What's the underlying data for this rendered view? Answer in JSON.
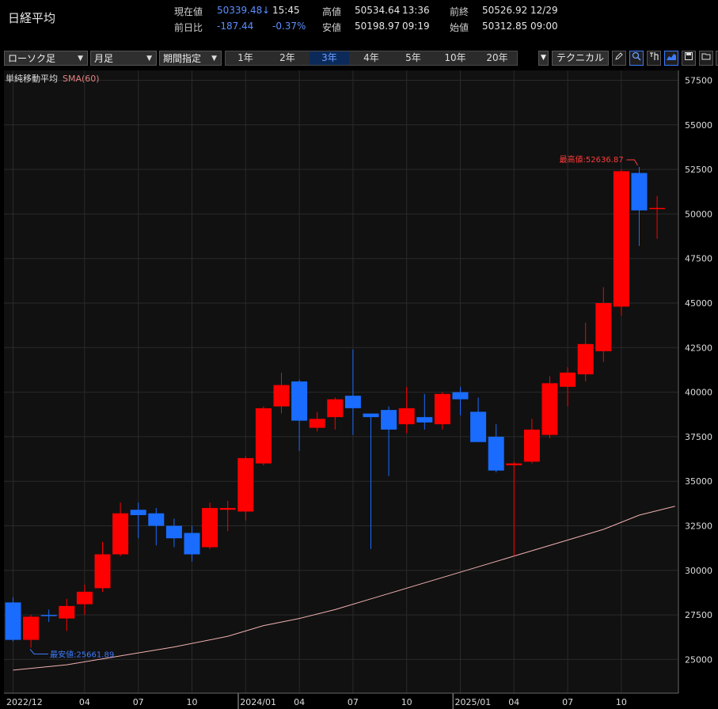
{
  "header": {
    "title": "日経平均",
    "current_label": "現在値",
    "current_value": "50339.48",
    "current_arrow": "↓",
    "current_time": "15:45",
    "high_label": "高値",
    "high_value": "50534.64",
    "high_time": "13:36",
    "prev_label": "前終",
    "prev_value": "50526.92",
    "prev_date": "12/29",
    "change_label": "前日比",
    "change_value": "-187.44",
    "change_pct": "-0.37%",
    "low_label": "安値",
    "low_value": "50198.97",
    "low_time": "09:19",
    "open_label": "始値",
    "open_value": "50312.85",
    "open_time": "09:00"
  },
  "toolbar": {
    "chart_type": "ローソク足",
    "interval": "月足",
    "range_mode": "期間指定",
    "periods": [
      "1年",
      "2年",
      "3年",
      "4年",
      "5年",
      "10年",
      "20年"
    ],
    "active_period": "3年",
    "technical_label": "テクニカル",
    "dropdown_arrow": "▼",
    "icons": [
      "pencil-icon",
      "zoom-icon",
      "export-icon",
      "area-chart-icon",
      "save-icon",
      "folder-icon",
      "window-icon"
    ]
  },
  "colors": {
    "up": "#ff0000",
    "down": "#1a6cff",
    "sma": "#f0b0b0",
    "grid": "#2a2a2a",
    "high_annot": "#ff3b3b",
    "low_annot": "#3b7bff"
  },
  "chart_data": {
    "type": "candlestick",
    "indicator_label": "単純移動平均",
    "indicator_name": "SMA(60)",
    "ylim": [
      24000,
      58000
    ],
    "y_ticks": [
      25000,
      27500,
      30000,
      32500,
      35000,
      37500,
      40000,
      42500,
      45000,
      47500,
      50000,
      52500,
      55000,
      57500
    ],
    "x_labels": [
      {
        "index": 0,
        "text": "2022/12"
      },
      {
        "index": 4,
        "text": "04"
      },
      {
        "index": 7,
        "text": "07"
      },
      {
        "index": 10,
        "text": "10"
      },
      {
        "index": 13,
        "text": "2024/01"
      },
      {
        "index": 16,
        "text": "04"
      },
      {
        "index": 19,
        "text": "07"
      },
      {
        "index": 22,
        "text": "10"
      },
      {
        "index": 25,
        "text": "2025/01"
      },
      {
        "index": 28,
        "text": "04"
      },
      {
        "index": 31,
        "text": "07"
      },
      {
        "index": 34,
        "text": "10"
      }
    ],
    "year_separators": [
      13,
      25
    ],
    "candles": [
      {
        "o": 28200,
        "h": 28500,
        "l": 26000,
        "c": 26100
      },
      {
        "o": 26100,
        "h": 27500,
        "l": 25662,
        "c": 27400
      },
      {
        "o": 27500,
        "h": 27800,
        "l": 27100,
        "c": 27450
      },
      {
        "o": 27300,
        "h": 28400,
        "l": 26600,
        "c": 28000
      },
      {
        "o": 28100,
        "h": 29200,
        "l": 27500,
        "c": 28800
      },
      {
        "o": 29000,
        "h": 31600,
        "l": 28800,
        "c": 30900
      },
      {
        "o": 30900,
        "h": 33800,
        "l": 30800,
        "c": 33200
      },
      {
        "o": 33400,
        "h": 33800,
        "l": 31800,
        "c": 33100
      },
      {
        "o": 33200,
        "h": 33500,
        "l": 31400,
        "c": 32500
      },
      {
        "o": 32500,
        "h": 32900,
        "l": 31300,
        "c": 31800
      },
      {
        "o": 32100,
        "h": 32500,
        "l": 30500,
        "c": 30900
      },
      {
        "o": 31300,
        "h": 33800,
        "l": 31200,
        "c": 33500
      },
      {
        "o": 33400,
        "h": 33900,
        "l": 32200,
        "c": 33500
      },
      {
        "o": 33300,
        "h": 36400,
        "l": 32800,
        "c": 36300
      },
      {
        "o": 36000,
        "h": 39200,
        "l": 35900,
        "c": 39100
      },
      {
        "o": 39200,
        "h": 41100,
        "l": 38800,
        "c": 40400
      },
      {
        "o": 40600,
        "h": 40700,
        "l": 36700,
        "c": 38400
      },
      {
        "o": 38000,
        "h": 38900,
        "l": 37800,
        "c": 38500
      },
      {
        "o": 38600,
        "h": 39700,
        "l": 37900,
        "c": 39600
      },
      {
        "o": 39800,
        "h": 42400,
        "l": 37600,
        "c": 39100
      },
      {
        "o": 38800,
        "h": 38800,
        "l": 31200,
        "c": 38600
      },
      {
        "o": 39000,
        "h": 39200,
        "l": 35300,
        "c": 37900
      },
      {
        "o": 38200,
        "h": 40300,
        "l": 37700,
        "c": 39100
      },
      {
        "o": 38600,
        "h": 39900,
        "l": 37900,
        "c": 38300
      },
      {
        "o": 38200,
        "h": 40000,
        "l": 37900,
        "c": 39900
      },
      {
        "o": 40000,
        "h": 40300,
        "l": 38700,
        "c": 39600
      },
      {
        "o": 38900,
        "h": 39700,
        "l": 37600,
        "c": 37200
      },
      {
        "o": 37500,
        "h": 38200,
        "l": 35500,
        "c": 35600
      },
      {
        "o": 35900,
        "h": 36100,
        "l": 30800,
        "c": 36000
      },
      {
        "o": 36100,
        "h": 38500,
        "l": 36000,
        "c": 37900
      },
      {
        "o": 37600,
        "h": 40900,
        "l": 37400,
        "c": 40500
      },
      {
        "o": 40300,
        "h": 41400,
        "l": 39200,
        "c": 41100
      },
      {
        "o": 41000,
        "h": 43900,
        "l": 40600,
        "c": 42700
      },
      {
        "o": 42300,
        "h": 45900,
        "l": 41700,
        "c": 45000
      },
      {
        "o": 44800,
        "h": 52500,
        "l": 44300,
        "c": 52400
      },
      {
        "o": 52300,
        "h": 52637,
        "l": 48200,
        "c": 50200
      },
      {
        "o": 50312,
        "h": 51000,
        "l": 48600,
        "c": 50339
      }
    ],
    "sma60": [
      {
        "index": 0,
        "value": 24400
      },
      {
        "index": 3,
        "value": 24700
      },
      {
        "index": 6,
        "value": 25200
      },
      {
        "index": 9,
        "value": 25700
      },
      {
        "index": 12,
        "value": 26300
      },
      {
        "index": 14,
        "value": 26900
      },
      {
        "index": 16,
        "value": 27300
      },
      {
        "index": 18,
        "value": 27800
      },
      {
        "index": 20,
        "value": 28400
      },
      {
        "index": 22,
        "value": 29000
      },
      {
        "index": 24,
        "value": 29600
      },
      {
        "index": 26,
        "value": 30200
      },
      {
        "index": 28,
        "value": 30800
      },
      {
        "index": 30,
        "value": 31400
      },
      {
        "index": 33,
        "value": 32300
      },
      {
        "index": 35,
        "value": 33100
      },
      {
        "index": 37,
        "value": 33600
      }
    ],
    "annotations": {
      "high_text": "最高値:52636.87",
      "high_value": 52636.87,
      "high_index": 35,
      "low_text": "最安値:25661.89",
      "low_value": 25661.89,
      "low_index": 1
    }
  }
}
